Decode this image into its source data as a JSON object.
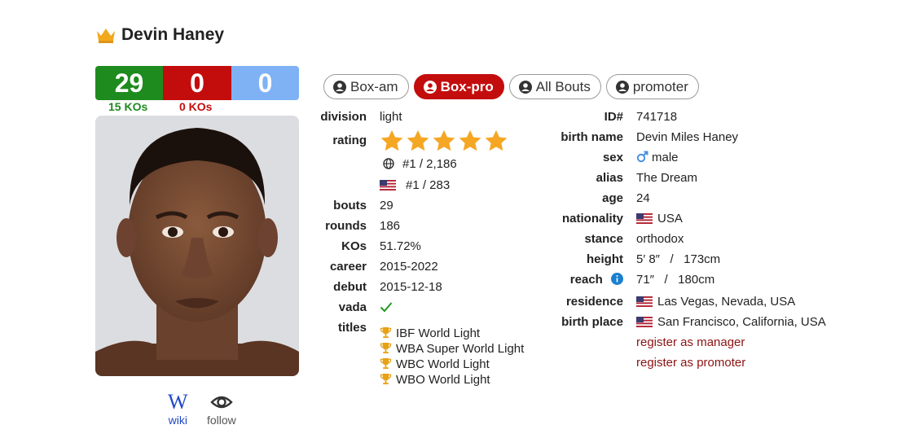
{
  "boxer": {
    "name": "Devin Haney"
  },
  "record": {
    "wins": "29",
    "losses": "0",
    "draws": "0",
    "win_kos": "15 KOs",
    "loss_kos": "0 KOs"
  },
  "links": {
    "wiki": "wiki",
    "follow": "follow"
  },
  "tabs": [
    {
      "label": "Box-am",
      "active": false
    },
    {
      "label": "Box-pro",
      "active": true
    },
    {
      "label": "All Bouts",
      "active": false
    },
    {
      "label": "promoter",
      "active": false
    }
  ],
  "left_info": {
    "division": {
      "label": "division",
      "value": "light"
    },
    "rating": {
      "label": "rating",
      "stars": 5,
      "world_rank": "#1 / 2,186",
      "country_rank": "#1 / 283"
    },
    "bouts": {
      "label": "bouts",
      "value": "29"
    },
    "rounds": {
      "label": "rounds",
      "value": "186"
    },
    "kos": {
      "label": "KOs",
      "value": "51.72%"
    },
    "career": {
      "label": "career",
      "value": "2015-2022"
    },
    "debut": {
      "label": "debut",
      "value": "2015-12-18"
    },
    "vada": {
      "label": "vada"
    },
    "titles": {
      "label": "titles",
      "items": [
        "IBF World Light",
        "WBA Super World Light",
        "WBC World Light",
        "WBO World Light"
      ]
    }
  },
  "right_info": {
    "id": {
      "label": "ID#",
      "value": "741718"
    },
    "birth_name": {
      "label": "birth name",
      "value": "Devin Miles Haney"
    },
    "sex": {
      "label": "sex",
      "value": "male"
    },
    "alias": {
      "label": "alias",
      "value": "The Dream"
    },
    "age": {
      "label": "age",
      "value": "24"
    },
    "nationality": {
      "label": "nationality",
      "value": "USA"
    },
    "stance": {
      "label": "stance",
      "value": "orthodox"
    },
    "height": {
      "label": "height",
      "value": "5′ 8″   /   173cm"
    },
    "reach": {
      "label": "reach",
      "value": "71″   /   180cm"
    },
    "residence": {
      "label": "residence",
      "value": "Las Vegas, Nevada, USA"
    },
    "birth_place": {
      "label": "birth place",
      "value": "San Francisco, California, USA"
    },
    "register_manager": "register as manager",
    "register_promoter": "register as promoter"
  },
  "colors": {
    "win": "#1e8b1e",
    "loss": "#c30d0d",
    "draw": "#7fb2f5",
    "star": "#f5a623",
    "link_red": "#8b1313"
  }
}
